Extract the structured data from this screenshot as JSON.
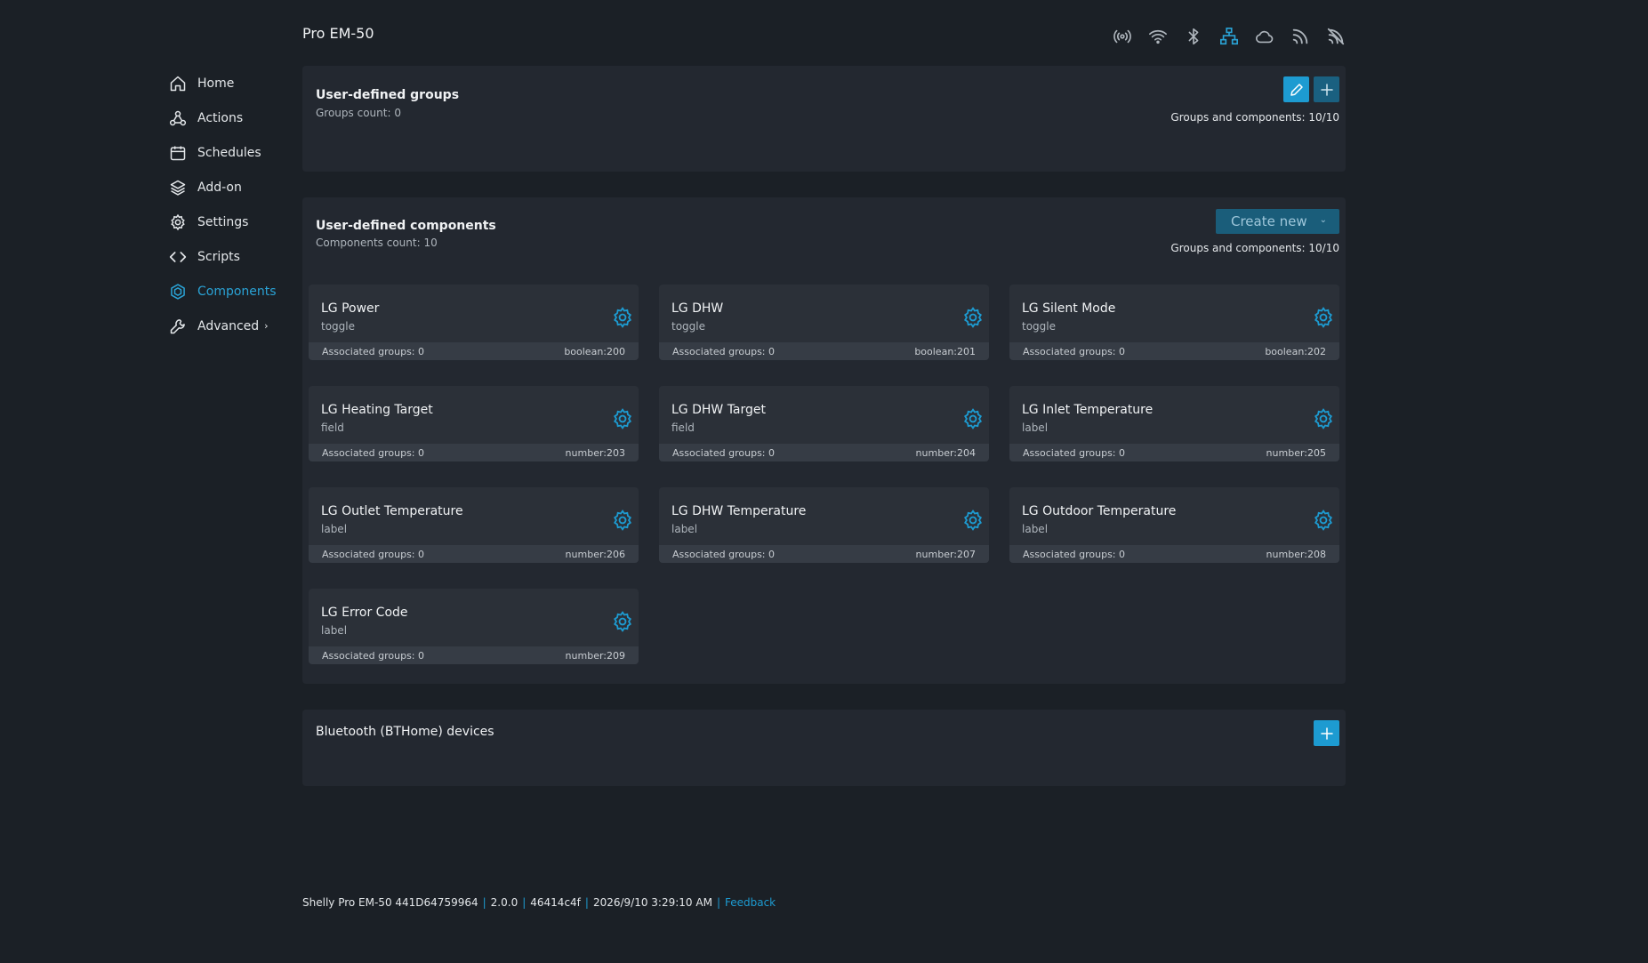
{
  "device": {
    "title": "Pro EM-50"
  },
  "sidebar": {
    "items": [
      {
        "label": "Home",
        "icon": "home-icon"
      },
      {
        "label": "Actions",
        "icon": "actions-icon"
      },
      {
        "label": "Schedules",
        "icon": "calendar-icon"
      },
      {
        "label": "Add-on",
        "icon": "layers-icon"
      },
      {
        "label": "Settings",
        "icon": "gear-icon"
      },
      {
        "label": "Scripts",
        "icon": "code-icon"
      },
      {
        "label": "Components",
        "icon": "components-icon",
        "active": true
      },
      {
        "label": "Advanced",
        "icon": "wrench-icon",
        "chevron": "›"
      }
    ]
  },
  "status_icons": [
    "ap-icon",
    "wifi-icon",
    "bluetooth-icon",
    "ethernet-icon",
    "cloud-icon",
    "rss-icon",
    "feed-disabled-icon"
  ],
  "groups": {
    "title": "User-defined groups",
    "subtitle": "Groups count: 0",
    "limit": "Groups and components: 10/10"
  },
  "components": {
    "title": "User-defined components",
    "subtitle": "Components count: 10",
    "create_label": "Create new",
    "create_caret": "⌄",
    "limit": "Groups and components: 10/10",
    "cards": [
      {
        "name": "LG Power",
        "type": "toggle",
        "groups": "Associated groups: 0",
        "id": "boolean:200"
      },
      {
        "name": "LG DHW",
        "type": "toggle",
        "groups": "Associated groups: 0",
        "id": "boolean:201"
      },
      {
        "name": "LG Silent Mode",
        "type": "toggle",
        "groups": "Associated groups: 0",
        "id": "boolean:202"
      },
      {
        "name": "LG Heating Target",
        "type": "field",
        "groups": "Associated groups: 0",
        "id": "number:203"
      },
      {
        "name": "LG DHW Target",
        "type": "field",
        "groups": "Associated groups: 0",
        "id": "number:204"
      },
      {
        "name": "LG Inlet Temperature",
        "type": "label",
        "groups": "Associated groups: 0",
        "id": "number:205"
      },
      {
        "name": "LG Outlet Temperature",
        "type": "label",
        "groups": "Associated groups: 0",
        "id": "number:206"
      },
      {
        "name": "LG DHW Temperature",
        "type": "label",
        "groups": "Associated groups: 0",
        "id": "number:207"
      },
      {
        "name": "LG Outdoor Temperature",
        "type": "label",
        "groups": "Associated groups: 0",
        "id": "number:208"
      },
      {
        "name": "LG Error Code",
        "type": "label",
        "groups": "Associated groups: 0",
        "id": "number:209"
      }
    ]
  },
  "bthome": {
    "title": "Bluetooth (BTHome) devices"
  },
  "footer": {
    "device": "Shelly Pro EM-50 441D64759964",
    "version": "2.0.0",
    "build": "46414c4f",
    "datetime": "2026/9/10 3:29:10 AM",
    "feedback": "Feedback",
    "separator": "|"
  },
  "colors": {
    "accent": "#1d9bd1",
    "background": "#1b2026",
    "panel": "#232830",
    "card": "#2b3038"
  }
}
